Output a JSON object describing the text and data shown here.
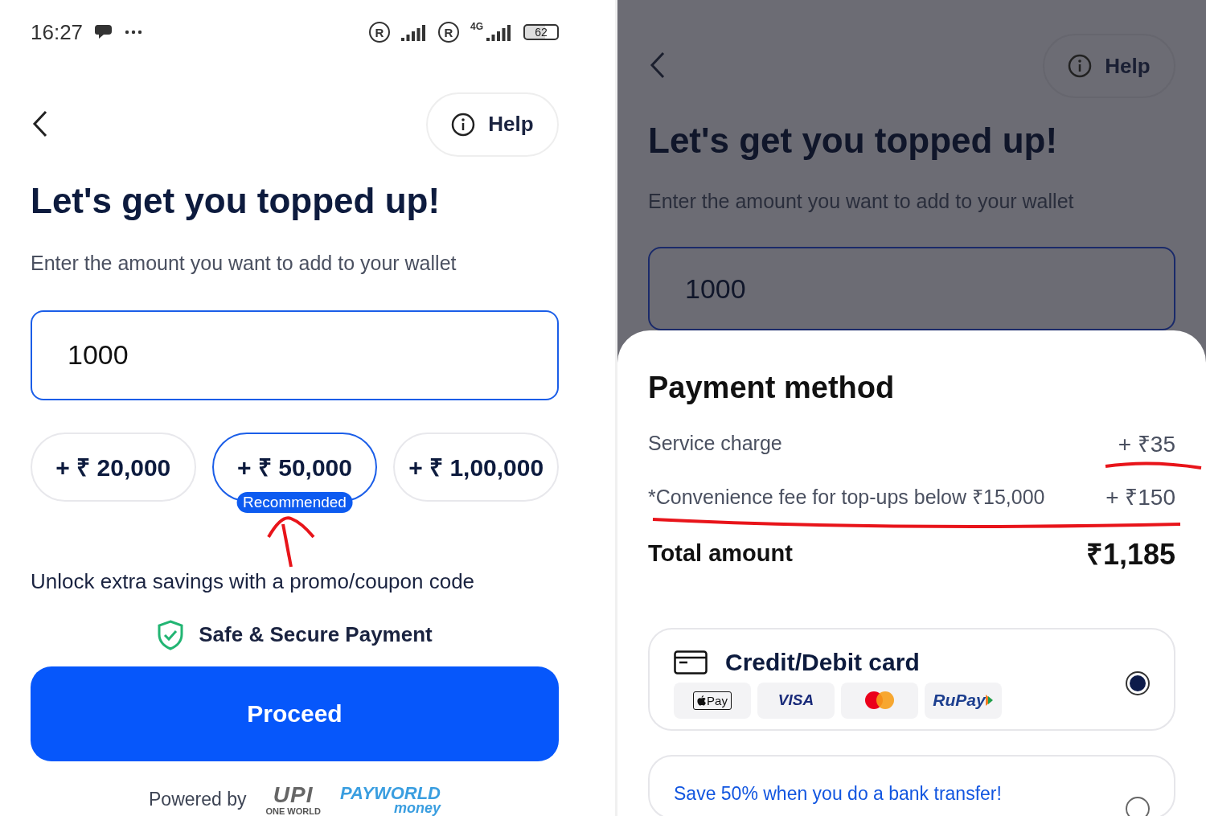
{
  "status_bar": {
    "time": "16:27",
    "sims": [
      {
        "roaming": "R"
      },
      {
        "roaming": "R",
        "network": "4G"
      }
    ],
    "battery": "62"
  },
  "topup_screen": {
    "help": "Help",
    "title": "Let's get you topped up!",
    "subtitle": "Enter the amount you want to add to your wallet",
    "amount": "1000",
    "quick_amounts": [
      {
        "label": "+ ₹ 20,000",
        "selected": false
      },
      {
        "label": "+ ₹ 50,000",
        "selected": true,
        "badge": "Recommended"
      },
      {
        "label": "+ ₹ 1,00,000",
        "selected": false
      }
    ],
    "promo": "Unlock extra savings with a promo/coupon code",
    "secure": "Safe & Secure Payment",
    "proceed": "Proceed",
    "powered_by": "Powered by",
    "upi_logo": {
      "mark": "UPI",
      "tagline": "ONE WORLD"
    },
    "payworld_logo": {
      "mark": "PAYWORLD",
      "sub": "money"
    }
  },
  "payment_screen": {
    "help": "Help",
    "title": "Let's get you topped up!",
    "subtitle": "Enter the amount you want to add to your wallet",
    "amount": "1000",
    "sheet": {
      "title": "Payment method",
      "rows": [
        {
          "kind": "charge",
          "label": "Service charge",
          "value": "+ ₹35"
        },
        {
          "kind": "charge",
          "label": "*Convenience fee for top-ups below ₹15,000",
          "value": "+ ₹150"
        },
        {
          "kind": "total",
          "label": "Total amount",
          "value": "₹1,185"
        }
      ],
      "methods": [
        {
          "kind": "card",
          "title": "Credit/Debit card",
          "selected": true,
          "brands": [
            {
              "kind": "applepay",
              "label": "Pay"
            },
            {
              "kind": "visa",
              "label": "VISA"
            },
            {
              "kind": "mastercard"
            },
            {
              "kind": "rupay",
              "label": "RuPay"
            }
          ]
        },
        {
          "kind": "offer",
          "title": "Save 50% when you do a bank transfer!",
          "selected": false
        }
      ]
    }
  }
}
